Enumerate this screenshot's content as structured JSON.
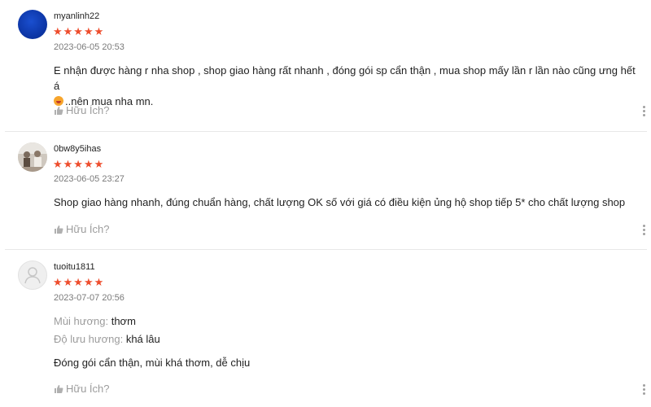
{
  "reviews": [
    {
      "username": "myanlinh22",
      "stars": "★★★★★",
      "date": "2023-06-05 20:53",
      "comment_line1": "E nhận được hàng r nha shop , shop giao hàng rất nhanh , đóng gói sp cẩn thận , mua shop mấy lần r lần nào cũng ưng hết á",
      "comment_line2": "..nên mua nha mn.",
      "helpful": "Hữu Ích?"
    },
    {
      "username": "0bw8y5ihas",
      "stars": "★★★★★",
      "date": "2023-06-05 23:27",
      "comment": "Shop giao hàng nhanh, đúng chuẩn hàng, chất lượng OK số với giá có điều kiện ủng hộ shop tiếp 5* cho chất lượng shop",
      "helpful": "Hữu Ích?"
    },
    {
      "username": "tuoitu1811",
      "stars": "★★★★★",
      "date": "2023-07-07 20:56",
      "attributes": [
        {
          "key": "Mùi hương:",
          "value": "thơm"
        },
        {
          "key": "Độ lưu hương:",
          "value": "khá lâu"
        }
      ],
      "comment": "Đóng gói cẩn thận, mùi khá thơm, dễ chịu",
      "helpful": "Hữu Ích?"
    }
  ],
  "colors": {
    "star": "#ee4d2d",
    "avatar_blue": "#0d37a8"
  },
  "icons": {
    "helpful": "thumbs-up-icon",
    "more": "more-vertical-icon",
    "default_avatar": "user-icon"
  }
}
